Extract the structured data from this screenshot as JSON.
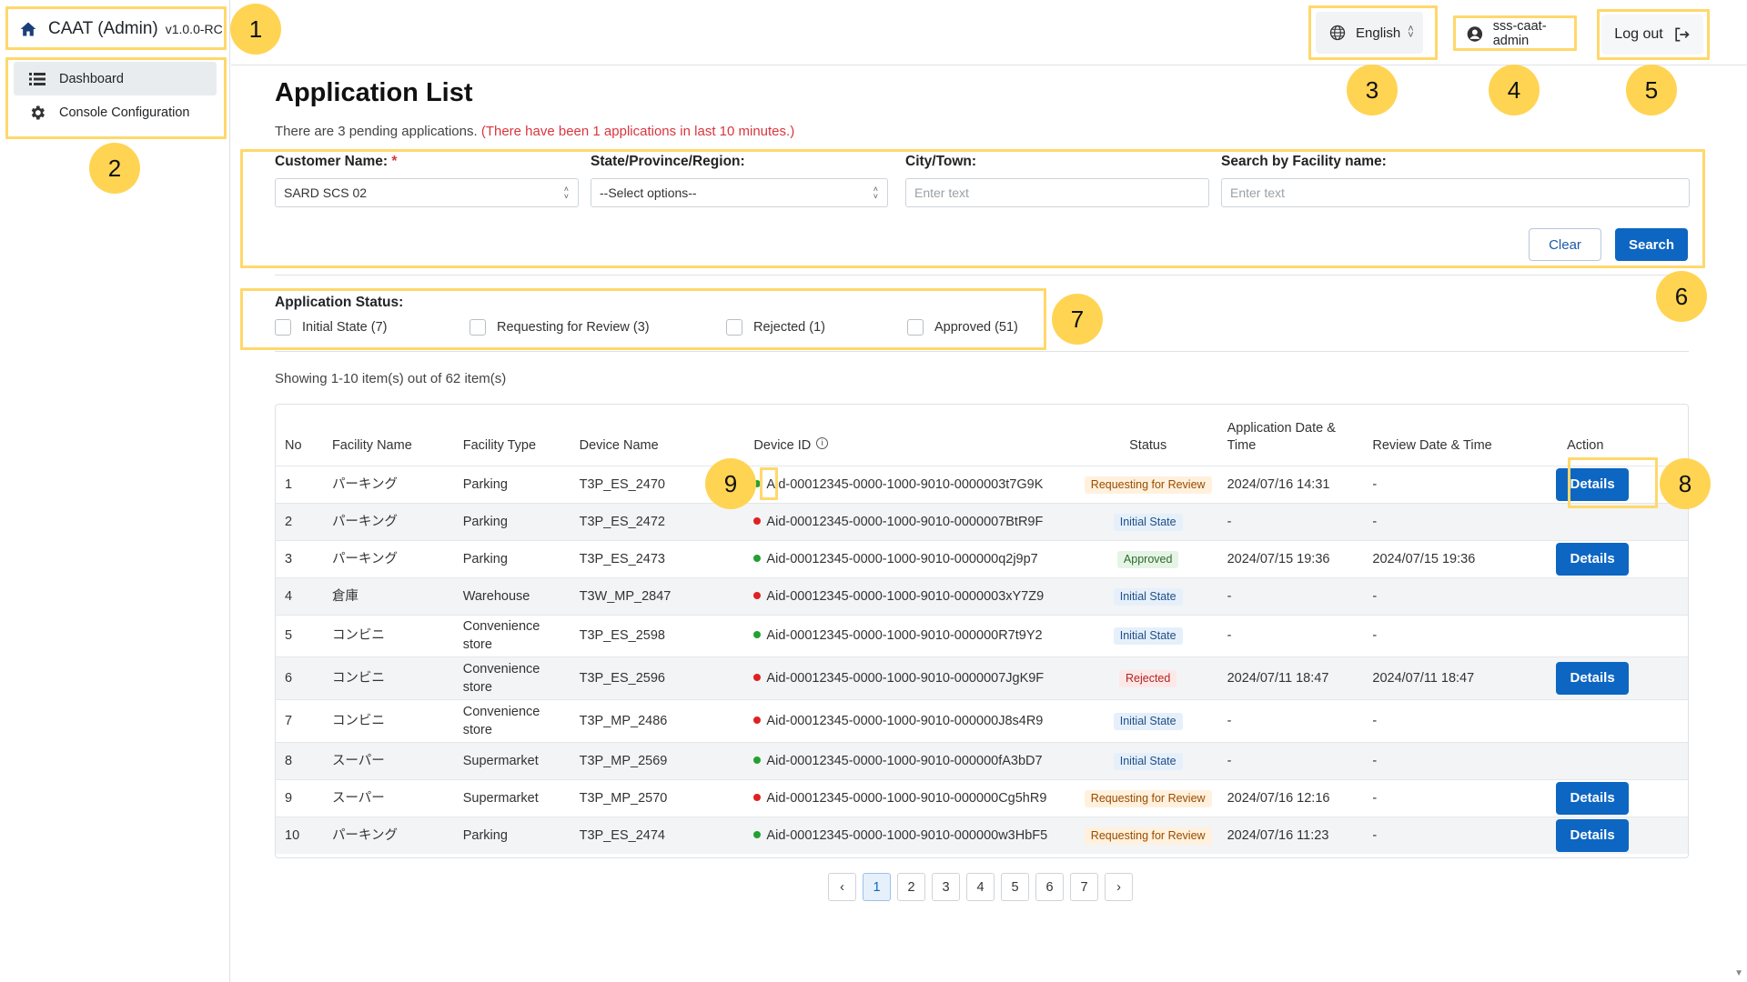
{
  "app": {
    "title": "CAAT (Admin)",
    "version": "v1.0.0-RC"
  },
  "sidebar": {
    "items": [
      {
        "label": "Dashboard",
        "icon": "list-icon",
        "active": true
      },
      {
        "label": "Console Configuration",
        "icon": "gear-icon",
        "active": false
      }
    ]
  },
  "topbar": {
    "language": "English",
    "username": "sss-caat-admin",
    "logout_label": "Log out"
  },
  "callouts": [
    "1",
    "2",
    "3",
    "4",
    "5",
    "6",
    "7",
    "8",
    "9"
  ],
  "page": {
    "title": "Application List",
    "pending_text": "There are 3 pending applications.",
    "recent_text": "(There have been 1 applications in last 10 minutes.)"
  },
  "filters": {
    "customer_label": "Customer Name:",
    "required_mark": "*",
    "customer_value": "SARD SCS 02",
    "state_label": "State/Province/Region:",
    "state_value": "--Select options--",
    "city_label": "City/Town:",
    "city_placeholder": "Enter text",
    "facility_label": "Search by Facility name:",
    "facility_placeholder": "Enter text",
    "clear_label": "Clear",
    "search_label": "Search"
  },
  "status_filter": {
    "label": "Application Status:",
    "options": [
      "Initial State (7)",
      "Requesting for Review (3)",
      "Rejected (1)",
      "Approved (51)"
    ]
  },
  "showing_text": "Showing 1-10 item(s) out of 62 item(s)",
  "table": {
    "headers": [
      "No",
      "Facility Name",
      "Facility Type",
      "Device Name",
      "Device ID",
      "Status",
      "Application Date & Time",
      "Review Date & Time",
      "Action"
    ],
    "details_label": "Details",
    "rows": [
      {
        "no": "1",
        "facility": "パーキング",
        "type": "Parking",
        "device": "T3P_ES_2470",
        "dot": "green",
        "device_id": "Aid-00012345-0000-1000-9010-0000003t7G9K",
        "status": "Requesting for Review",
        "status_kind": "review",
        "app_date": "2024/07/16 14:31",
        "review_date": "-",
        "action": true
      },
      {
        "no": "2",
        "facility": "パーキング",
        "type": "Parking",
        "device": "T3P_ES_2472",
        "dot": "red",
        "device_id": "Aid-00012345-0000-1000-9010-0000007BtR9F",
        "status": "Initial State",
        "status_kind": "initial",
        "app_date": "-",
        "review_date": "-",
        "action": false
      },
      {
        "no": "3",
        "facility": "パーキング",
        "type": "Parking",
        "device": "T3P_ES_2473",
        "dot": "green",
        "device_id": "Aid-00012345-0000-1000-9010-000000q2j9p7",
        "status": "Approved",
        "status_kind": "approved",
        "app_date": "2024/07/15 19:36",
        "review_date": "2024/07/15 19:36",
        "action": true
      },
      {
        "no": "4",
        "facility": "倉庫",
        "type": "Warehouse",
        "device": "T3W_MP_2847",
        "dot": "red",
        "device_id": "Aid-00012345-0000-1000-9010-0000003xY7Z9",
        "status": "Initial State",
        "status_kind": "initial",
        "app_date": "-",
        "review_date": "-",
        "action": false
      },
      {
        "no": "5",
        "facility": "コンビニ",
        "type": "Convenience store",
        "device": "T3P_ES_2598",
        "dot": "green",
        "device_id": "Aid-00012345-0000-1000-9010-000000R7t9Y2",
        "status": "Initial State",
        "status_kind": "initial",
        "app_date": "-",
        "review_date": "-",
        "action": false
      },
      {
        "no": "6",
        "facility": "コンビニ",
        "type": "Convenience store",
        "device": "T3P_ES_2596",
        "dot": "red",
        "device_id": "Aid-00012345-0000-1000-9010-0000007JgK9F",
        "status": "Rejected",
        "status_kind": "rejected",
        "app_date": "2024/07/11 18:47",
        "review_date": "2024/07/11 18:47",
        "action": true
      },
      {
        "no": "7",
        "facility": "コンビニ",
        "type": "Convenience store",
        "device": "T3P_MP_2486",
        "dot": "red",
        "device_id": "Aid-00012345-0000-1000-9010-000000J8s4R9",
        "status": "Initial State",
        "status_kind": "initial",
        "app_date": "-",
        "review_date": "-",
        "action": false
      },
      {
        "no": "8",
        "facility": "スーパー",
        "type": "Supermarket",
        "device": "T3P_MP_2569",
        "dot": "green",
        "device_id": "Aid-00012345-0000-1000-9010-000000fA3bD7",
        "status": "Initial State",
        "status_kind": "initial",
        "app_date": "-",
        "review_date": "-",
        "action": false
      },
      {
        "no": "9",
        "facility": "スーパー",
        "type": "Supermarket",
        "device": "T3P_MP_2570",
        "dot": "red",
        "device_id": "Aid-00012345-0000-1000-9010-000000Cg5hR9",
        "status": "Requesting for Review",
        "status_kind": "review",
        "app_date": "2024/07/16 12:16",
        "review_date": "-",
        "action": true
      },
      {
        "no": "10",
        "facility": "パーキング",
        "type": "Parking",
        "device": "T3P_ES_2474",
        "dot": "green",
        "device_id": "Aid-00012345-0000-1000-9010-000000w3HbF5",
        "status": "Requesting for Review",
        "status_kind": "review",
        "app_date": "2024/07/16 11:23",
        "review_date": "-",
        "action": true
      }
    ]
  },
  "pagination": {
    "prev": "‹",
    "next": "›",
    "pages": [
      "1",
      "2",
      "3",
      "4",
      "5",
      "6",
      "7"
    ],
    "current": "1"
  }
}
